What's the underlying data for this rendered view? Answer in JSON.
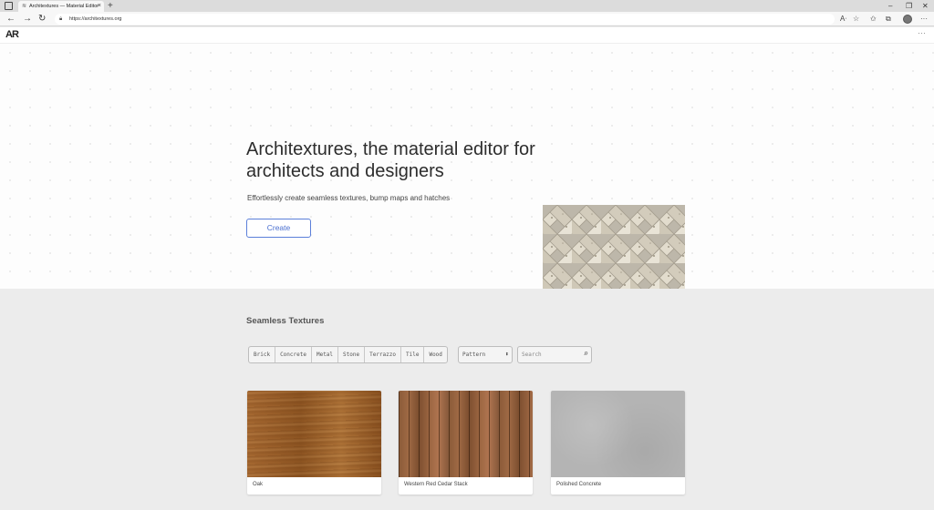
{
  "browser": {
    "tab_title": "Architextures — Material Editor",
    "tab_close": "×",
    "new_tab": "+",
    "url": "https://architextures.org",
    "window_controls": {
      "minimize": "–",
      "restore": "❐",
      "close": "✕"
    },
    "icons": [
      "read-aloud-icon",
      "favorite-add-icon",
      "favorites-icon",
      "collections-icon",
      "profile-icon",
      "more-icon"
    ]
  },
  "site": {
    "logo": "AR",
    "menu": "···"
  },
  "hero": {
    "title": "Architextures, the material editor for architects and designers",
    "subtitle": "Effortlessly create seamless textures, bump maps and hatches",
    "cta": "Create"
  },
  "textures": {
    "title": "Seamless Textures",
    "filters": [
      "Brick",
      "Concrete",
      "Metal",
      "Stone",
      "Terrazzo",
      "Tile",
      "Wood"
    ],
    "pattern_select": "Pattern",
    "search_placeholder": "Search",
    "cards": [
      {
        "label": "Oak"
      },
      {
        "label": "Western Red Cedar Stack"
      },
      {
        "label": "Polished Concrete"
      }
    ]
  }
}
